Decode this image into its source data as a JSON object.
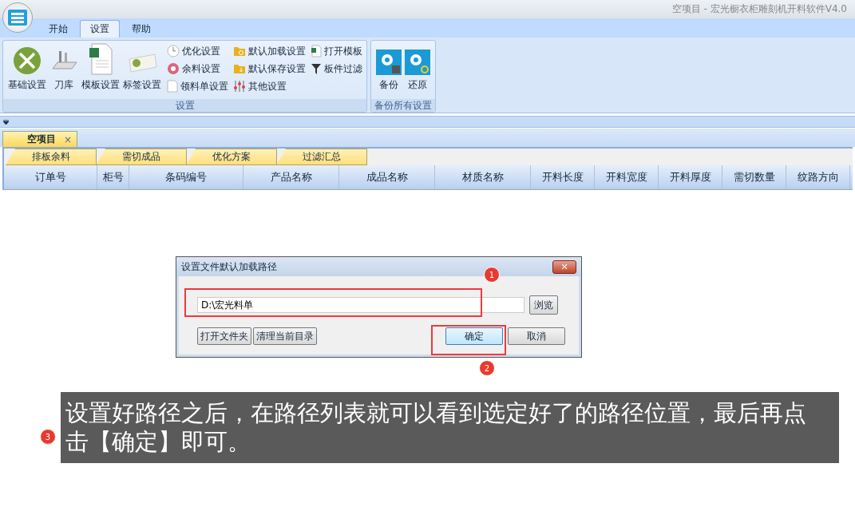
{
  "window": {
    "title": "空项目 - 宏光橱衣柜雕刻机开料软件V4.0"
  },
  "ribbon_tabs": [
    {
      "label": "开始",
      "selected": false
    },
    {
      "label": "设置",
      "selected": true
    },
    {
      "label": "帮助",
      "selected": false
    }
  ],
  "ribbon_groups": [
    {
      "label": "设置",
      "large_buttons": [
        "基础设置",
        "刀库",
        "模板设置",
        "标签设置"
      ],
      "small_button_columns": [
        [
          "优化设置",
          "余料设置",
          "领料单设置"
        ],
        [
          "默认加载设置",
          "默认保存设置",
          "其他设置"
        ],
        [
          "打开模板",
          "板件过滤"
        ]
      ]
    },
    {
      "label": "备份所有设置",
      "large_buttons": [
        "备份",
        "还原"
      ]
    }
  ],
  "document_tabs": [
    {
      "label": "空项目",
      "selected": true,
      "close": "×"
    }
  ],
  "sub_tabs": [
    {
      "label": "排板余料",
      "selected": false
    },
    {
      "label": "需切成品",
      "selected": false
    },
    {
      "label": "优化方案",
      "selected": false
    },
    {
      "label": "过滤汇总",
      "selected": false
    }
  ],
  "table": {
    "columns": [
      "订单号",
      "柜号",
      "条码编号",
      "产品名称",
      "成品名称",
      "材质名称",
      "开料长度",
      "开料宽度",
      "开料厚度",
      "需切数量",
      "纹路方向"
    ]
  },
  "dialog": {
    "title": "设置文件默认加载路径",
    "close": "✕",
    "path": "D:\\宏光料单",
    "browse": "浏览",
    "left_buttons": [
      "打开文件夹",
      "清理当前目录"
    ],
    "ok": "确定",
    "cancel": "取消"
  },
  "annotations": {
    "markers": [
      "1",
      "2",
      "3"
    ],
    "caption": "设置好路径之后，在路径列表就可以看到选定好了的路径位置，最后再点击【确定】即可。"
  }
}
